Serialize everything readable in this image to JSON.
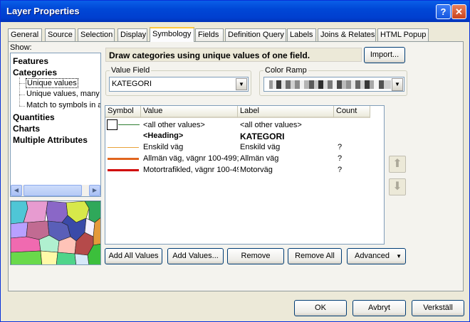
{
  "window": {
    "title": "Layer Properties"
  },
  "tabs": [
    "General",
    "Source",
    "Selection",
    "Display",
    "Symbology",
    "Fields",
    "Definition Query",
    "Labels",
    "Joins & Relates",
    "HTML Popup"
  ],
  "active_tab": "Symbology",
  "show": {
    "label": "Show:",
    "tree": {
      "features": "Features",
      "categories": "Categories",
      "unique_values": "Unique values",
      "unique_values_many": "Unique values, many f",
      "match_to_symbols": "Match to symbols in a",
      "quantities": "Quantities",
      "charts": "Charts",
      "multiple_attributes": "Multiple Attributes"
    }
  },
  "description": "Draw categories using unique values of one field.",
  "import_label": "Import...",
  "value_field": {
    "label": "Value Field",
    "value": "KATEGORI"
  },
  "color_ramp": {
    "label": "Color Ramp"
  },
  "table": {
    "headers": {
      "symbol": "Symbol",
      "value": "Value",
      "label": "Label",
      "count": "Count"
    },
    "rows": [
      {
        "value": "<all other values>",
        "label": "<all other values>",
        "count": "",
        "symbol_color": "#2e7d32"
      },
      {
        "value": "<Heading>",
        "label": "KATEGORI",
        "count": ""
      },
      {
        "value": "Enskild väg",
        "label": "Enskild väg",
        "count": "?",
        "symbol_color": "#e8a23a"
      },
      {
        "value": "Allmän väg, vägnr 100-499;",
        "label": "Allmän väg",
        "count": "?",
        "symbol_color": "#e0651e"
      },
      {
        "value": "Motortrafikled, vägnr 100-49",
        "label": "Motorväg",
        "count": "?",
        "symbol_color": "#d00000"
      }
    ]
  },
  "buttons": {
    "add_all_values": "Add All Values",
    "add_values": "Add Values...",
    "remove": "Remove",
    "remove_all": "Remove All",
    "advanced": "Advanced"
  },
  "footer": {
    "ok": "OK",
    "cancel": "Avbryt",
    "apply": "Verkställ"
  },
  "colors": {
    "titlebar": "#0047d6",
    "window_bg": "#ece9d8",
    "active_tab_accent": "#ffc83c"
  }
}
